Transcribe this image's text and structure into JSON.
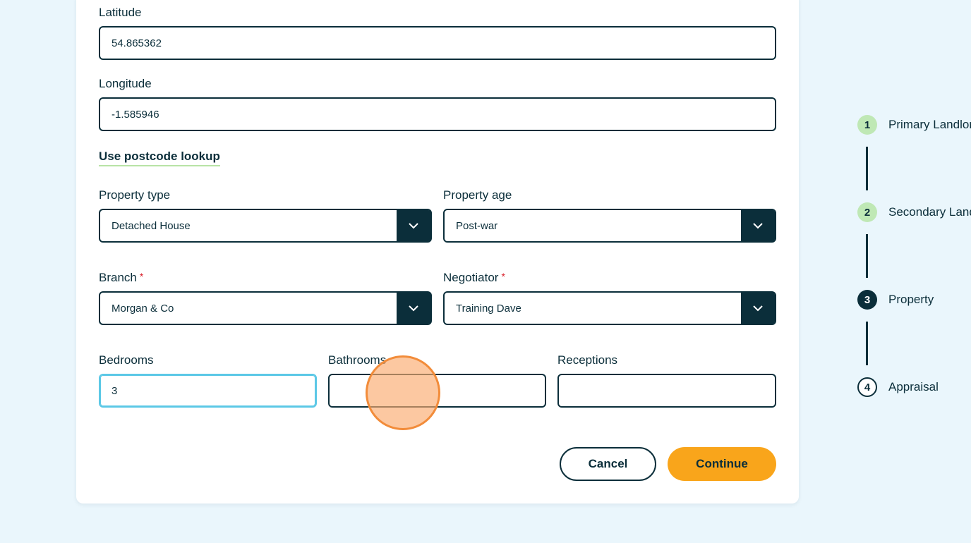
{
  "form": {
    "latitude": {
      "label": "Latitude",
      "value": "54.865362"
    },
    "longitude": {
      "label": "Longitude",
      "value": "-1.585946"
    },
    "postcode_link": "Use postcode lookup",
    "property_type": {
      "label": "Property type",
      "value": "Detached House"
    },
    "property_age": {
      "label": "Property age",
      "value": "Post-war"
    },
    "branch": {
      "label": "Branch",
      "required": "*",
      "value": "Morgan & Co"
    },
    "negotiator": {
      "label": "Negotiator",
      "required": "*",
      "value": "Training Dave"
    },
    "bedrooms": {
      "label": "Bedrooms",
      "value": "3"
    },
    "bathrooms": {
      "label": "Bathrooms",
      "value": ""
    },
    "receptions": {
      "label": "Receptions",
      "value": ""
    },
    "cancel_label": "Cancel",
    "continue_label": "Continue"
  },
  "stepper": {
    "steps": [
      {
        "number": "1",
        "label": "Primary Landlord",
        "state": "done"
      },
      {
        "number": "2",
        "label": "Secondary Landlord",
        "state": "done"
      },
      {
        "number": "3",
        "label": "Property",
        "state": "active"
      },
      {
        "number": "4",
        "label": "Appraisal",
        "state": "todo"
      }
    ]
  },
  "colors": {
    "primary": "#0b2e3a",
    "accent": "#f9a51b",
    "done_step": "#bfe8b5",
    "focus": "#5bc8e6",
    "background": "#eaf6fc"
  }
}
